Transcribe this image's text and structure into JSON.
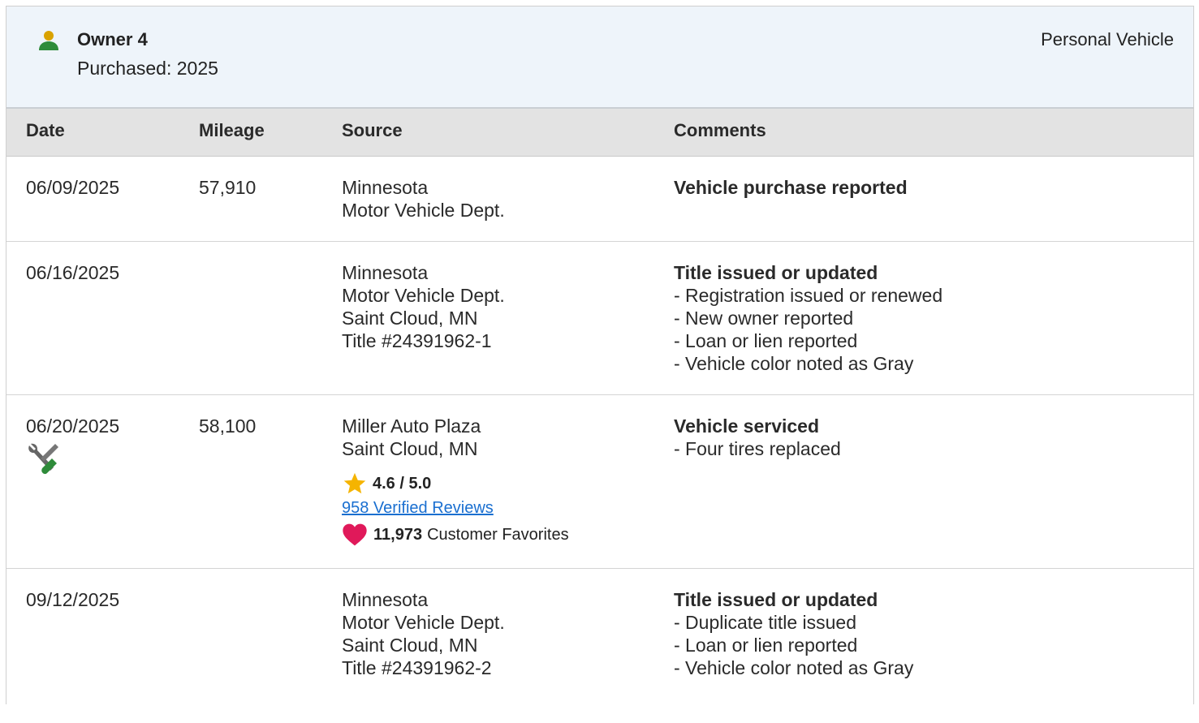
{
  "owner": {
    "name": "Owner 4",
    "purchased": "Purchased: 2025",
    "type": "Personal Vehicle"
  },
  "columns": {
    "date": "Date",
    "mileage": "Mileage",
    "source": "Source",
    "comments": "Comments"
  },
  "rows": [
    {
      "date": "06/09/2025",
      "mileage": "57,910",
      "source": [
        "Minnesota",
        "Motor Vehicle Dept."
      ],
      "comment_title": "Vehicle purchase reported",
      "comment_items": []
    },
    {
      "date": "06/16/2025",
      "mileage": "",
      "source": [
        "Minnesota",
        "Motor Vehicle Dept.",
        "Saint Cloud, MN",
        "Title #24391962-1"
      ],
      "comment_title": "Title issued or updated",
      "comment_items": [
        "- Registration issued or renewed",
        "- New owner reported",
        "- Loan or lien reported",
        "- Vehicle color noted as Gray"
      ]
    },
    {
      "date": "06/20/2025",
      "mileage": "58,100",
      "source": [
        "Miller Auto Plaza",
        "Saint Cloud, MN"
      ],
      "rating": "4.6 / 5.0",
      "reviews": "958 Verified Reviews",
      "favorites_count": "11,973",
      "favorites_label": "Customer Favorites",
      "icon": "service-tools-icon",
      "comment_title": "Vehicle serviced",
      "comment_items": [
        "- Four tires replaced"
      ]
    },
    {
      "date": "09/12/2025",
      "mileage": "",
      "source": [
        "Minnesota",
        "Motor Vehicle Dept.",
        "Saint Cloud, MN",
        "Title #24391962-2"
      ],
      "comment_title": "Title issued or updated",
      "comment_items": [
        "- Duplicate title issued",
        "- Loan or lien reported",
        "- Vehicle color noted as Gray"
      ]
    }
  ],
  "colors": {
    "header_bg": "#eef4fa",
    "column_header_bg": "#e3e3e3",
    "owner_icon_head": "#d9a200",
    "owner_icon_body": "#2e8b3a",
    "star": "#f5b400",
    "heart": "#e0195a",
    "link": "#1a6fd0"
  }
}
